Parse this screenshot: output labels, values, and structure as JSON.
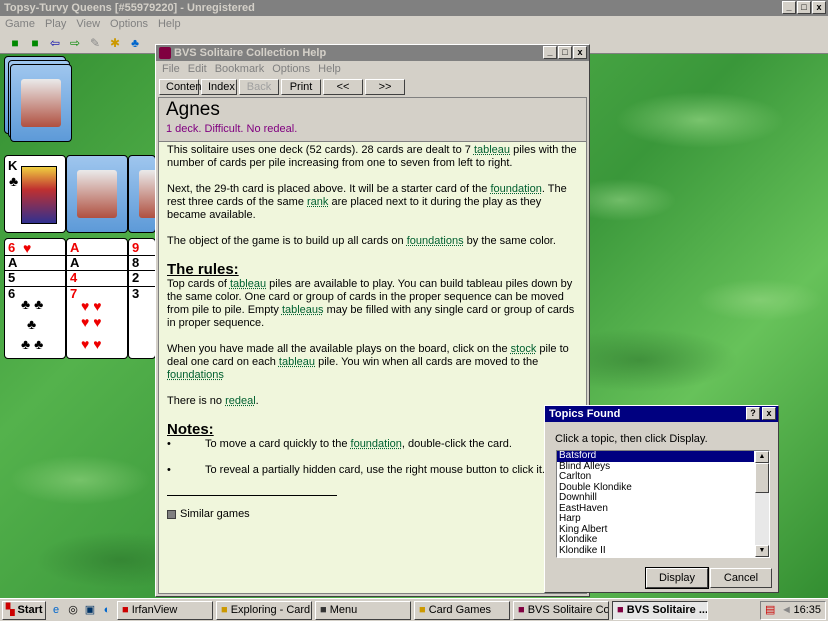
{
  "main_window": {
    "title": "Topsy-Turvy Queens [#55979220] - Unregistered",
    "menu": [
      "Game",
      "Play",
      "View",
      "Options",
      "Help"
    ],
    "controls": [
      "_",
      "□",
      "x"
    ]
  },
  "help_window": {
    "title": "BVS Solitaire Collection Help",
    "menu": [
      "File",
      "Edit",
      "Bookmark",
      "Options",
      "Help"
    ],
    "buttons": [
      "Contents",
      "Index",
      "Back",
      "Print",
      "<<",
      ">>"
    ],
    "heading": "Agnes",
    "subtitle": "1 deck. Difficult. No redeal.",
    "p1": {
      "a": "This solitaire uses one deck (52 cards). 28 cards are dealt to 7 ",
      "link": "tableau",
      "b": " piles with the number of cards per pile increasing from one to seven from left to right."
    },
    "p2": {
      "a": "Next, the 29-th card is placed above. It will be a starter card of the ",
      "link1": "foundation",
      "b": ". The rest three cards of the same ",
      "link2": "rank",
      "c": " are placed next to it during the play as they became available."
    },
    "p3": {
      "a": "The object of the game is to build up all cards on ",
      "link": "foundations",
      "b": " by the same color."
    },
    "rules_heading": "The rules:",
    "r1": {
      "a": "Top cards of ",
      "link1": "tableau",
      "b": " piles are available to play. You can build tableau piles down by the same color. One card or group of cards in the proper sequence can be moved from pile to pile. Empty ",
      "link2": "tableaus",
      "c": " may be filled with any single card or group of cards in proper sequence."
    },
    "r2": {
      "a": "When you have made all the available plays on the board, click on the ",
      "link1": "stock",
      "b": " pile to deal one card on each ",
      "link2": "tableau",
      "c": " pile. You win when all cards are moved to the ",
      "link3": "foundations"
    },
    "r3": {
      "a": "There is no ",
      "link": "redeal",
      "b": "."
    },
    "notes_heading": "Notes:",
    "n1": {
      "bullet": "•",
      "a": "To move a card quickly to the ",
      "link": "foundation",
      "b": ", double-click the card."
    },
    "n2": {
      "bullet": "•",
      "a": "To reveal a partially hidden card, use the right mouse button to click it."
    },
    "similar": "Similar games"
  },
  "dialog": {
    "title": "Topics Found",
    "prompt": "Click a topic, then click Display.",
    "topics": [
      "Batsford",
      "Blind Alleys",
      "Carlton",
      "Double Klondike",
      "Downhill",
      "EastHaven",
      "Harp",
      "King Albert",
      "Klondike",
      "Klondike II"
    ],
    "selected_index": 0,
    "display_label": "Display",
    "cancel_label": "Cancel",
    "help_btn": "?",
    "close_btn": "x"
  },
  "cards": {
    "king": "K",
    "row1": [
      {
        "rank": "6",
        "suit": "♥",
        "red": true
      },
      {
        "rank": "A",
        "suit": "♥",
        "red": true
      },
      {
        "rank": "9",
        "suit": "♥",
        "red": true
      }
    ],
    "row2": [
      {
        "rank": "A",
        "suit": "♠",
        "red": false
      },
      {
        "rank": "A",
        "suit": "♠",
        "red": false
      },
      {
        "rank": "8",
        "suit": "♠",
        "red": false
      }
    ],
    "row3": [
      {
        "rank": "5",
        "suit": "♠",
        "red": false
      },
      {
        "rank": "4",
        "suit": "♥",
        "red": true
      },
      {
        "rank": "2",
        "suit": "♠",
        "red": false
      }
    ],
    "row4": [
      {
        "rank": "6",
        "suit": "♣",
        "red": false
      },
      {
        "rank": "7",
        "suit": "♥",
        "red": true
      },
      {
        "rank": "3",
        "suit": "♠",
        "red": false
      }
    ]
  },
  "taskbar": {
    "start": "Start",
    "tasks": [
      "IrfanView",
      "Exploring - Card G...",
      "Menu",
      "Card Games",
      "BVS Solitaire Colle...",
      "BVS Solitaire ..."
    ],
    "active_index": 5,
    "clock": "16:35"
  }
}
